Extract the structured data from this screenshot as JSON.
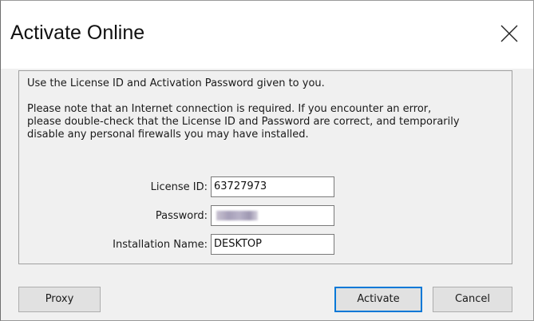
{
  "dialog": {
    "title": "Activate Online",
    "intro": "Use the License ID and Activation Password given to you.",
    "note_lines": [
      "Please note that an Internet connection is required. If you encounter an error,",
      "please double-check that the License ID and Password are correct, and temporarily",
      "disable any personal firewalls you may have installed."
    ],
    "fields": {
      "license_id": {
        "label": "License ID:",
        "value": "63727973"
      },
      "password": {
        "label": "Password:",
        "value": ""
      },
      "installation_name": {
        "label": "Installation Name:",
        "value": "DESKTOP"
      }
    },
    "buttons": {
      "proxy": "Proxy",
      "activate": "Activate",
      "cancel": "Cancel"
    }
  },
  "icons": {
    "close": "close-icon"
  },
  "colors": {
    "accent": "#0078d7",
    "background": "#f0f0f0",
    "titlebar": "#ffffff"
  }
}
